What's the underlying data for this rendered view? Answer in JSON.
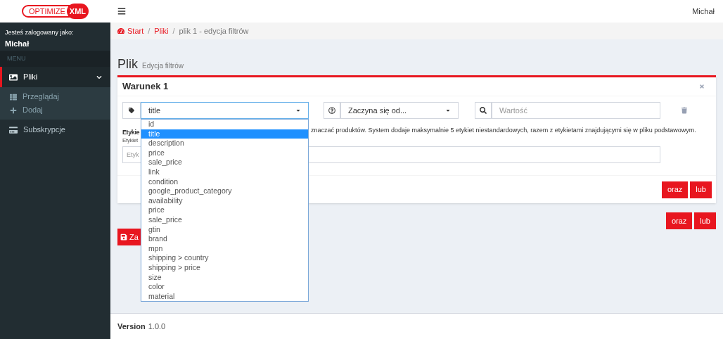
{
  "logo": {
    "left": "OPTIMIZE",
    "right": "XML"
  },
  "header": {
    "user": "Michał"
  },
  "sidebar": {
    "logged_label": "Jesteś zalogowany jako:",
    "user": "Michał",
    "menu_header": "MENU",
    "items": [
      {
        "label": "Pliki",
        "selected": true,
        "expanded": true,
        "children": [
          {
            "label": "Przeglądaj"
          },
          {
            "label": "Dodaj"
          }
        ]
      },
      {
        "label": "Subskrypcje",
        "selected": false
      }
    ]
  },
  "breadcrumb": [
    {
      "label": "Start",
      "kind": "link"
    },
    {
      "separator": "/",
      "label": "Pliki",
      "kind": "link"
    },
    {
      "separator": "/",
      "label": "plik 1 - edycja filtrów",
      "kind": "current"
    }
  ],
  "page": {
    "title": "Plik",
    "subtitle": "Edycja filtrów"
  },
  "condition": {
    "title": "Warunek 1",
    "field_select": {
      "value": "title",
      "expanded": true,
      "options": [
        {
          "label": "id",
          "selected": false
        },
        {
          "label": "title",
          "selected": true
        },
        {
          "label": "description",
          "selected": false
        },
        {
          "label": "price",
          "selected": false
        },
        {
          "label": "sale_price",
          "selected": false
        },
        {
          "label": "link",
          "selected": false
        },
        {
          "label": "condition",
          "selected": false
        },
        {
          "label": "google_product_category",
          "selected": false
        },
        {
          "label": "availability",
          "selected": false
        },
        {
          "label": "price",
          "selected": false
        },
        {
          "label": "sale_price",
          "selected": false
        },
        {
          "label": "gtin",
          "selected": false
        },
        {
          "label": "brand",
          "selected": false
        },
        {
          "label": "mpn",
          "selected": false
        },
        {
          "label": "shipping > country",
          "selected": false
        },
        {
          "label": "shipping > price",
          "selected": false
        },
        {
          "label": "size",
          "selected": false
        },
        {
          "label": "color",
          "selected": false
        },
        {
          "label": "material",
          "selected": false
        }
      ]
    },
    "operator_select": {
      "value": "Zaczyna się od..."
    },
    "value_field": {
      "placeholder": "Wartość"
    },
    "labels_heading": "Etykie",
    "labels_help": "znaczać produktów. System dodaje maksymalnie 5 etykiet niestandardowych, razem z etykietami znajdującymi się w pliku podstawowym.",
    "labels_field_label": "Etykiet",
    "labels_field": {
      "placeholder": "Etyk"
    },
    "buttons": [
      "oraz",
      "lub"
    ]
  },
  "outer_buttons": [
    "oraz",
    "lub"
  ],
  "save_button": "Za",
  "footer": {
    "label": "Version",
    "value": "1.0.0"
  }
}
